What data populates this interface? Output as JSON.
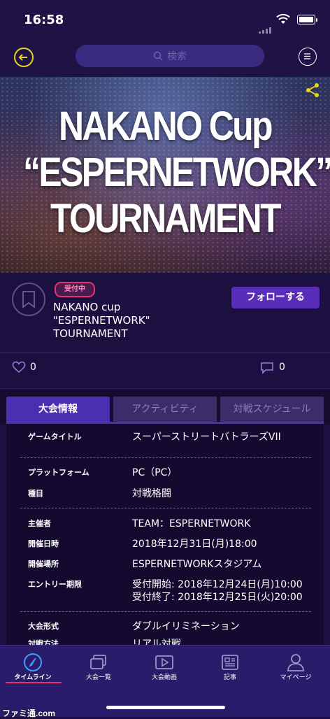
{
  "status_bar": {
    "time": "16:58"
  },
  "header": {
    "search_placeholder": "検索"
  },
  "hero": {
    "title_line1": "NAKANO Cup",
    "title_line2": "“ESPERNETWORK”",
    "title_line3": "TOURNAMENT"
  },
  "event": {
    "status_badge": "受付中",
    "title": "NAKANO cup\n\"ESPERNETWORK\"\nTOURNAMENT",
    "follow_label": "フォローする",
    "like_count": "0",
    "comment_count": "0"
  },
  "tabs": [
    "大会情報",
    "アクティビティ",
    "対戦スケジュール"
  ],
  "details": {
    "game_title_label": "ゲームタイトル",
    "game_title_value": "スーパーストリートバトラーズVII",
    "platform_label": "プラットフォーム",
    "platform_value": "PC（PC）",
    "category_label": "種目",
    "category_value": "対戦格闘",
    "organizer_label": "主催者",
    "organizer_value": "TEAM：ESPERNETWORK",
    "date_label": "開催日時",
    "date_value": "2018年12月31日(月)18:00",
    "venue_label": "開催場所",
    "venue_value": "ESPERNETWORKスタジアム",
    "entry_label": "エントリー期限",
    "entry_value": "受付開始: 2018年12月24日(月)10:00\n受付終了: 2018年12月25日(火)20:00",
    "format_label": "大会形式",
    "format_value": "ダブルイリミネーション",
    "method_label": "対戦方法",
    "method_value": "リアル対戦"
  },
  "bottom_nav": [
    {
      "label": "タイムライン",
      "icon": "compass-icon"
    },
    {
      "label": "大会一覧",
      "icon": "cards-icon"
    },
    {
      "label": "大会動画",
      "icon": "video-icon"
    },
    {
      "label": "記事",
      "icon": "news-icon"
    },
    {
      "label": "マイページ",
      "icon": "person-icon"
    }
  ],
  "watermark": "ファミ通.com",
  "colors": {
    "accent": "#4a2fb0",
    "badge": "#e8326e",
    "back_button": "#e8d61c",
    "background": "#1c1040"
  }
}
